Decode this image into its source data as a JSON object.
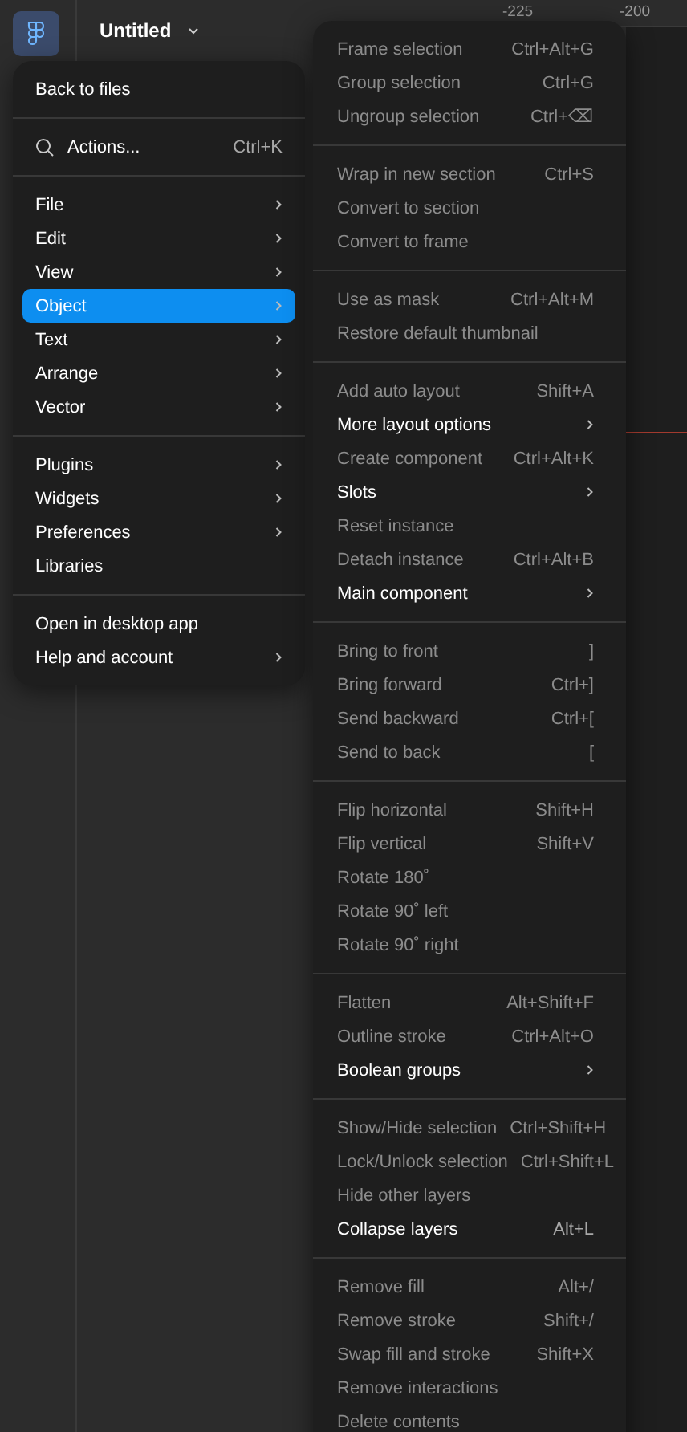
{
  "file_title": "Untitled",
  "ruler_labels": [
    "-225",
    "-200"
  ],
  "main_menu": [
    [
      {
        "label": "Back to files",
        "kind": "plain",
        "has_submenu": false,
        "selected": false
      }
    ],
    [
      {
        "label": "Actions...",
        "kind": "search",
        "shortcut": "Ctrl+K",
        "has_submenu": false,
        "selected": false
      }
    ],
    [
      {
        "label": "File",
        "kind": "plain",
        "has_submenu": true,
        "selected": false
      },
      {
        "label": "Edit",
        "kind": "plain",
        "has_submenu": true,
        "selected": false
      },
      {
        "label": "View",
        "kind": "plain",
        "has_submenu": true,
        "selected": false
      },
      {
        "label": "Object",
        "kind": "plain",
        "has_submenu": true,
        "selected": true
      },
      {
        "label": "Text",
        "kind": "plain",
        "has_submenu": true,
        "selected": false
      },
      {
        "label": "Arrange",
        "kind": "plain",
        "has_submenu": true,
        "selected": false
      },
      {
        "label": "Vector",
        "kind": "plain",
        "has_submenu": true,
        "selected": false
      }
    ],
    [
      {
        "label": "Plugins",
        "kind": "plain",
        "has_submenu": true,
        "selected": false
      },
      {
        "label": "Widgets",
        "kind": "plain",
        "has_submenu": true,
        "selected": false
      },
      {
        "label": "Preferences",
        "kind": "plain",
        "has_submenu": true,
        "selected": false
      },
      {
        "label": "Libraries",
        "kind": "plain",
        "has_submenu": false,
        "selected": false
      }
    ],
    [
      {
        "label": "Open in desktop app",
        "kind": "plain",
        "has_submenu": false,
        "selected": false
      },
      {
        "label": "Help and account",
        "kind": "plain",
        "has_submenu": true,
        "selected": false
      }
    ]
  ],
  "object_menu": [
    [
      {
        "label": "Frame selection",
        "shortcut": "Ctrl+Alt+G",
        "disabled": true,
        "has_submenu": false
      },
      {
        "label": "Group selection",
        "shortcut": "Ctrl+G",
        "disabled": true,
        "has_submenu": false
      },
      {
        "label": "Ungroup selection",
        "shortcut": "Ctrl+⌫",
        "disabled": true,
        "has_submenu": false
      }
    ],
    [
      {
        "label": "Wrap in new section",
        "shortcut": "Ctrl+S",
        "disabled": true,
        "has_submenu": false
      },
      {
        "label": "Convert to section",
        "disabled": true,
        "has_submenu": false
      },
      {
        "label": "Convert to frame",
        "disabled": true,
        "has_submenu": false
      }
    ],
    [
      {
        "label": "Use as mask",
        "shortcut": "Ctrl+Alt+M",
        "disabled": true,
        "has_submenu": false
      },
      {
        "label": "Restore default thumbnail",
        "disabled": true,
        "has_submenu": false
      }
    ],
    [
      {
        "label": "Add auto layout",
        "shortcut": "Shift+A",
        "disabled": true,
        "has_submenu": false
      },
      {
        "label": "More layout options",
        "disabled": false,
        "has_submenu": true
      },
      {
        "label": "Create component",
        "shortcut": "Ctrl+Alt+K",
        "disabled": true,
        "has_submenu": false
      },
      {
        "label": "Slots",
        "disabled": false,
        "has_submenu": true
      },
      {
        "label": "Reset instance",
        "disabled": true,
        "has_submenu": false
      },
      {
        "label": "Detach instance",
        "shortcut": "Ctrl+Alt+B",
        "disabled": true,
        "has_submenu": false
      },
      {
        "label": "Main component",
        "disabled": false,
        "has_submenu": true
      }
    ],
    [
      {
        "label": "Bring to front",
        "shortcut": "]",
        "disabled": true,
        "has_submenu": false
      },
      {
        "label": "Bring forward",
        "shortcut": "Ctrl+]",
        "disabled": true,
        "has_submenu": false
      },
      {
        "label": "Send backward",
        "shortcut": "Ctrl+[",
        "disabled": true,
        "has_submenu": false
      },
      {
        "label": "Send to back",
        "shortcut": "[",
        "disabled": true,
        "has_submenu": false
      }
    ],
    [
      {
        "label": "Flip horizontal",
        "shortcut": "Shift+H",
        "disabled": true,
        "has_submenu": false
      },
      {
        "label": "Flip vertical",
        "shortcut": "Shift+V",
        "disabled": true,
        "has_submenu": false
      },
      {
        "label": "Rotate 180˚",
        "disabled": true,
        "has_submenu": false
      },
      {
        "label": "Rotate 90˚ left",
        "disabled": true,
        "has_submenu": false
      },
      {
        "label": "Rotate 90˚ right",
        "disabled": true,
        "has_submenu": false
      }
    ],
    [
      {
        "label": "Flatten",
        "shortcut": "Alt+Shift+F",
        "disabled": true,
        "has_submenu": false
      },
      {
        "label": "Outline stroke",
        "shortcut": "Ctrl+Alt+O",
        "disabled": true,
        "has_submenu": false
      },
      {
        "label": "Boolean groups",
        "disabled": false,
        "has_submenu": true
      }
    ],
    [
      {
        "label": "Show/Hide selection",
        "shortcut": "Ctrl+Shift+H",
        "disabled": true,
        "has_submenu": false
      },
      {
        "label": "Lock/Unlock selection",
        "shortcut": "Ctrl+Shift+L",
        "disabled": true,
        "has_submenu": false
      },
      {
        "label": "Hide other layers",
        "disabled": true,
        "has_submenu": false
      },
      {
        "label": "Collapse layers",
        "shortcut": "Alt+L",
        "disabled": false,
        "has_submenu": false
      }
    ],
    [
      {
        "label": "Remove fill",
        "shortcut": "Alt+/",
        "disabled": true,
        "has_submenu": false
      },
      {
        "label": "Remove stroke",
        "shortcut": "Shift+/",
        "disabled": true,
        "has_submenu": false
      },
      {
        "label": "Swap fill and stroke",
        "shortcut": "Shift+X",
        "disabled": true,
        "has_submenu": false
      },
      {
        "label": "Remove interactions",
        "disabled": true,
        "has_submenu": false
      },
      {
        "label": "Delete contents",
        "disabled": true,
        "has_submenu": false
      }
    ]
  ]
}
